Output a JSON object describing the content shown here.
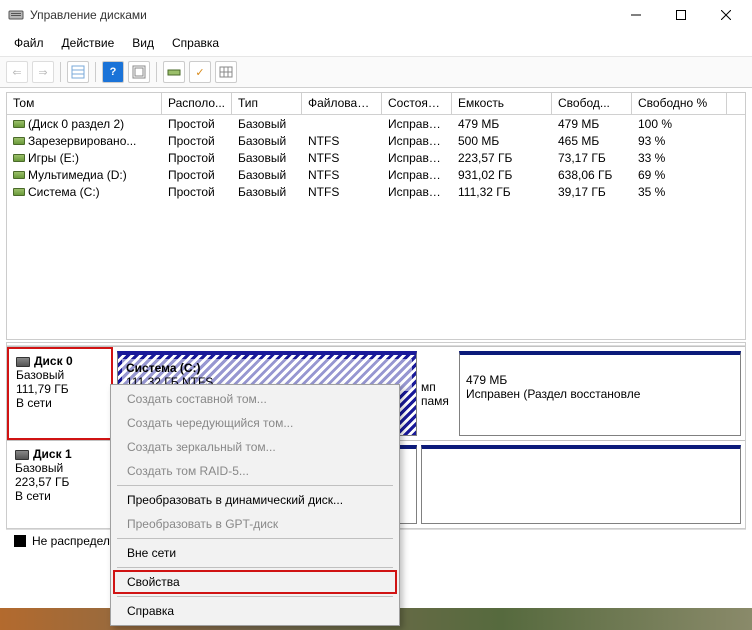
{
  "window": {
    "title": "Управление дисками"
  },
  "menu": {
    "file": "Файл",
    "action": "Действие",
    "view": "Вид",
    "help": "Справка"
  },
  "columns": {
    "tom": "Том",
    "raspo": "Располо...",
    "tip": "Тип",
    "fs": "Файловая с...",
    "state": "Состояние",
    "cap": "Емкость",
    "free": "Свобод...",
    "freep": "Свободно %"
  },
  "volumes": [
    {
      "name": "(Диск 0 раздел 2)",
      "layout": "Простой",
      "type": "Базовый",
      "fs": "",
      "state": "Исправен...",
      "cap": "479 МБ",
      "free": "479 МБ",
      "freep": "100 %"
    },
    {
      "name": "Зарезервировано...",
      "layout": "Простой",
      "type": "Базовый",
      "fs": "NTFS",
      "state": "Исправен...",
      "cap": "500 МБ",
      "free": "465 МБ",
      "freep": "93 %"
    },
    {
      "name": "Игры (E:)",
      "layout": "Простой",
      "type": "Базовый",
      "fs": "NTFS",
      "state": "Исправен...",
      "cap": "223,57 ГБ",
      "free": "73,17 ГБ",
      "freep": "33 %"
    },
    {
      "name": "Мультимедиа (D:)",
      "layout": "Простой",
      "type": "Базовый",
      "fs": "NTFS",
      "state": "Исправен...",
      "cap": "931,02 ГБ",
      "free": "638,06 ГБ",
      "freep": "69 %"
    },
    {
      "name": "Система (C:)",
      "layout": "Простой",
      "type": "Базовый",
      "fs": "NTFS",
      "state": "Исправен...",
      "cap": "111,32 ГБ",
      "free": "39,17 ГБ",
      "freep": "35 %"
    }
  ],
  "disks": {
    "d0": {
      "title": "Диск 0",
      "type": "Базовый",
      "size": "111,79 ГБ",
      "status": "В сети",
      "p1": {
        "title": "Система  (C:)",
        "sub": "111,32 ГБ NTFS"
      },
      "p2": {
        "title_extra": "мп памя"
      },
      "p3": {
        "size": "479 МБ",
        "status": "Исправен (Раздел восстановле"
      }
    },
    "d1": {
      "title": "Диск 1",
      "type": "Базовый",
      "size": "223,57 ГБ",
      "status": "В сети"
    }
  },
  "legend": {
    "unalloc": "Не распредел"
  },
  "context_menu": {
    "i0": "Создать составной том...",
    "i1": "Создать чередующийся том...",
    "i2": "Создать зеркальный том...",
    "i3": "Создать том RAID-5...",
    "i4": "Преобразовать в динамический диск...",
    "i5": "Преобразовать в GPT-диск",
    "i6": "Вне сети",
    "i7": "Свойства",
    "i8": "Справка"
  }
}
